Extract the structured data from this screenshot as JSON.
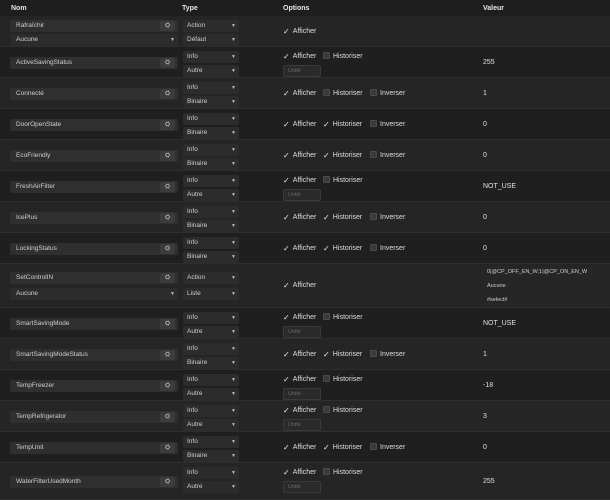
{
  "headers": {
    "nom": "Nom",
    "type": "Type",
    "options": "Options",
    "valeur": "Valeur"
  },
  "labels": {
    "afficher": "Afficher",
    "historiser": "Historiser",
    "inverser": "Inverser",
    "unite": "Unité",
    "config_icon": "⛭"
  },
  "rows": [
    {
      "name": "Rafraîchir",
      "sub": "Aucune",
      "type": "Action",
      "subtype": "Défaut",
      "afficher": true,
      "historiser": null,
      "inverser": null,
      "unite": false,
      "value": "",
      "value_lines": []
    },
    {
      "name": "ActiveSavingStatus",
      "sub": null,
      "type": "Info",
      "subtype": "Autre",
      "afficher": true,
      "historiser": false,
      "inverser": null,
      "unite": true,
      "value": "255",
      "value_lines": []
    },
    {
      "name": "Connecté",
      "sub": null,
      "type": "Info",
      "subtype": "Binaire",
      "afficher": true,
      "historiser": false,
      "inverser": false,
      "unite": false,
      "value": "1",
      "value_lines": []
    },
    {
      "name": "DoorOpenState",
      "sub": null,
      "type": "Info",
      "subtype": "Binaire",
      "afficher": true,
      "historiser": true,
      "inverser": false,
      "unite": false,
      "value": "0",
      "value_lines": []
    },
    {
      "name": "EcoFriendly",
      "sub": null,
      "type": "Info",
      "subtype": "Binaire",
      "afficher": true,
      "historiser": true,
      "inverser": false,
      "unite": false,
      "value": "0",
      "value_lines": []
    },
    {
      "name": "FreshAirFilter",
      "sub": null,
      "type": "Info",
      "subtype": "Autre",
      "afficher": true,
      "historiser": false,
      "inverser": null,
      "unite": true,
      "value": "NOT_USE",
      "value_lines": []
    },
    {
      "name": "IcePlus",
      "sub": null,
      "type": "Info",
      "subtype": "Binaire",
      "afficher": true,
      "historiser": true,
      "inverser": false,
      "unite": false,
      "value": "0",
      "value_lines": []
    },
    {
      "name": "LockingStatus",
      "sub": null,
      "type": "Info",
      "subtype": "Binaire",
      "afficher": true,
      "historiser": true,
      "inverser": false,
      "unite": false,
      "value": "0",
      "value_lines": []
    },
    {
      "name": "SetControlIN",
      "sub": "Aucune",
      "type": "Action",
      "subtype": "Liste",
      "afficher": true,
      "historiser": null,
      "inverser": null,
      "unite": false,
      "value": "",
      "value_lines": [
        "0|@CP_OFF_EN_W;1|@CP_ON_EN_W",
        "Aucune",
        "#select#"
      ]
    },
    {
      "name": "SmartSavingMode",
      "sub": null,
      "type": "Info",
      "subtype": "Autre",
      "afficher": true,
      "historiser": false,
      "inverser": null,
      "unite": true,
      "value": "NOT_USE",
      "value_lines": []
    },
    {
      "name": "SmartSavingModeStatus",
      "sub": null,
      "type": "Info",
      "subtype": "Binaire",
      "afficher": true,
      "historiser": true,
      "inverser": false,
      "unite": false,
      "value": "1",
      "value_lines": []
    },
    {
      "name": "TempFreezer",
      "sub": null,
      "type": "Info",
      "subtype": "Autre",
      "afficher": true,
      "historiser": false,
      "inverser": null,
      "unite": true,
      "value": "-18",
      "value_lines": []
    },
    {
      "name": "TempRefrigerator",
      "sub": null,
      "type": "Info",
      "subtype": "Autre",
      "afficher": true,
      "historiser": false,
      "inverser": null,
      "unite": true,
      "value": "3",
      "value_lines": []
    },
    {
      "name": "TempUnit",
      "sub": null,
      "type": "Info",
      "subtype": "Binaire",
      "afficher": true,
      "historiser": true,
      "inverser": false,
      "unite": false,
      "value": "0",
      "value_lines": []
    },
    {
      "name": "WaterFilterUsedMonth",
      "sub": null,
      "type": "Info",
      "subtype": "Autre",
      "afficher": true,
      "historiser": false,
      "inverser": null,
      "unite": true,
      "value": "255",
      "value_lines": []
    }
  ]
}
